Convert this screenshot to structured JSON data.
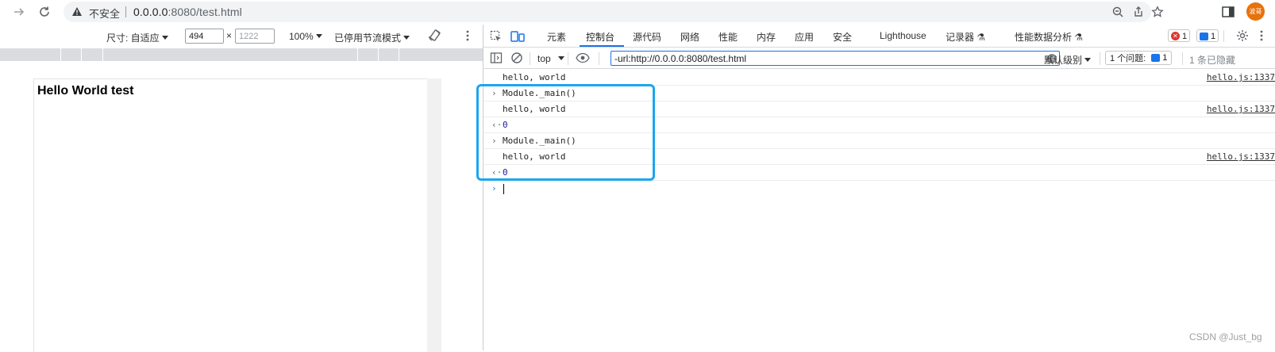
{
  "browser": {
    "security_text": "不安全",
    "url_host": "0.0.0.0",
    "url_rest": ":8080/test.html",
    "avatar_text": "波哥"
  },
  "device_toolbar": {
    "size_label": "尺寸: 自适应",
    "width_value": "494",
    "height_value": "1222",
    "times": "×",
    "zoom": "100%",
    "throttle": "已停用节流模式"
  },
  "page": {
    "heading": "Hello World test"
  },
  "devtools": {
    "tabs": [
      "元素",
      "控制台",
      "源代码",
      "网络",
      "性能",
      "内存",
      "应用",
      "安全",
      "Lighthouse",
      "记录器",
      "性能数据分析"
    ],
    "active_tab": "控制台",
    "error_count": "1",
    "message_count": "1",
    "context": "top",
    "filter_value": "-url:http://0.0.0.0:8080/test.html",
    "level": "默认级别",
    "issues_label": "1 个问题:",
    "issues_count": "1",
    "hidden_label": "1 条已隐藏"
  },
  "console": {
    "rows": [
      {
        "kind": "log",
        "text": "hello, world",
        "source": "hello.js:1337"
      },
      {
        "kind": "input",
        "text": "Module._main()",
        "source": ""
      },
      {
        "kind": "log",
        "text": "hello, world",
        "source": "hello.js:1337"
      },
      {
        "kind": "result",
        "text": "0",
        "source": ""
      },
      {
        "kind": "input",
        "text": "Module._main()",
        "source": ""
      },
      {
        "kind": "log",
        "text": "hello, world",
        "source": "hello.js:1337"
      },
      {
        "kind": "result",
        "text": "0",
        "source": ""
      }
    ]
  },
  "watermark": "CSDN @Just_bg",
  "colors": {
    "accent": "#1a73e8",
    "highlight_box": "#1ba6ef",
    "error_red": "#dc362e"
  }
}
